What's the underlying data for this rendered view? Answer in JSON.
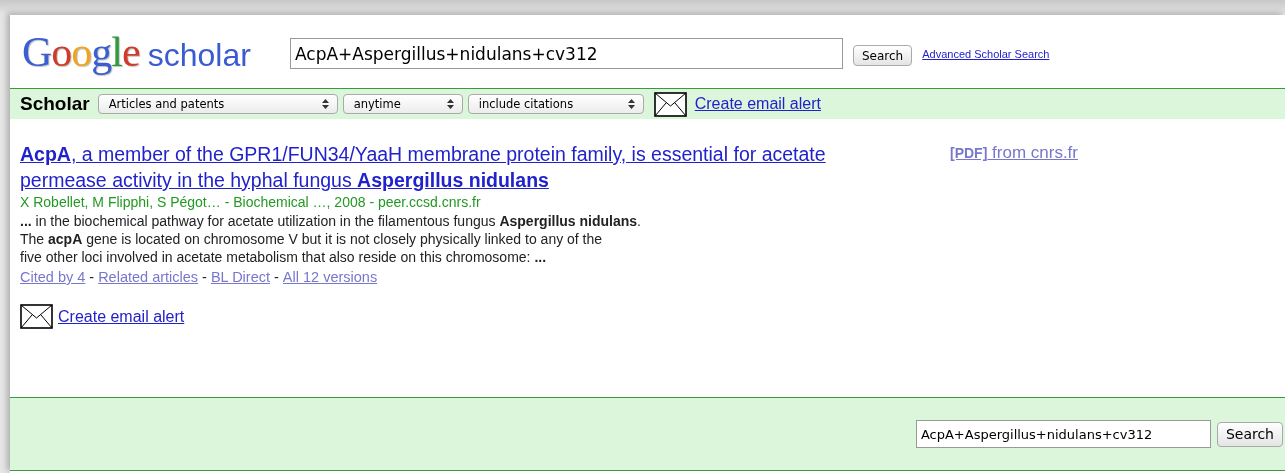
{
  "header": {
    "logo_word": "Google",
    "logo_suffix": "scholar",
    "query": "AcpA+Aspergillus+nidulans+cv312",
    "search_button": "Search",
    "advanced_link": "Advanced Scholar Search"
  },
  "filter_bar": {
    "label": "Scholar",
    "dropdowns": [
      {
        "value": "Articles and patents"
      },
      {
        "value": "anytime"
      },
      {
        "value": "include citations"
      }
    ],
    "alert_link": "Create email alert"
  },
  "results": [
    {
      "title": "**AcpA**, a member of the GPR1/FUN34/YaaH membrane protein family, is essential for acetate permease activity in the hyphal fungus **Aspergillus nidulans**",
      "side_tag": "[PDF]",
      "side_source": "from cnrs.fr",
      "authors": "X Robellet, M Flipphi, S Pégot… - Biochemical …, 2008 - peer.ccsd.cnrs.fr",
      "snippet": [
        "**...** in the biochemical pathway for acetate utilization in the filamentous fungus **Aspergillus nidulans**.",
        "The **acpA** gene is located on chromosome V but it is not closely physically linked to any of the",
        "five other loci involved in acetate metabolism that also reside on this chromosome: **...**"
      ],
      "links": [
        "Cited by 4",
        "Related articles",
        "BL Direct",
        "All 12 versions"
      ],
      "separator": "-"
    }
  ],
  "alert_link": "Create email alert",
  "footer": {
    "query": "AcpA+Aspergillus+nidulans+cv312",
    "search_button": "Search"
  }
}
